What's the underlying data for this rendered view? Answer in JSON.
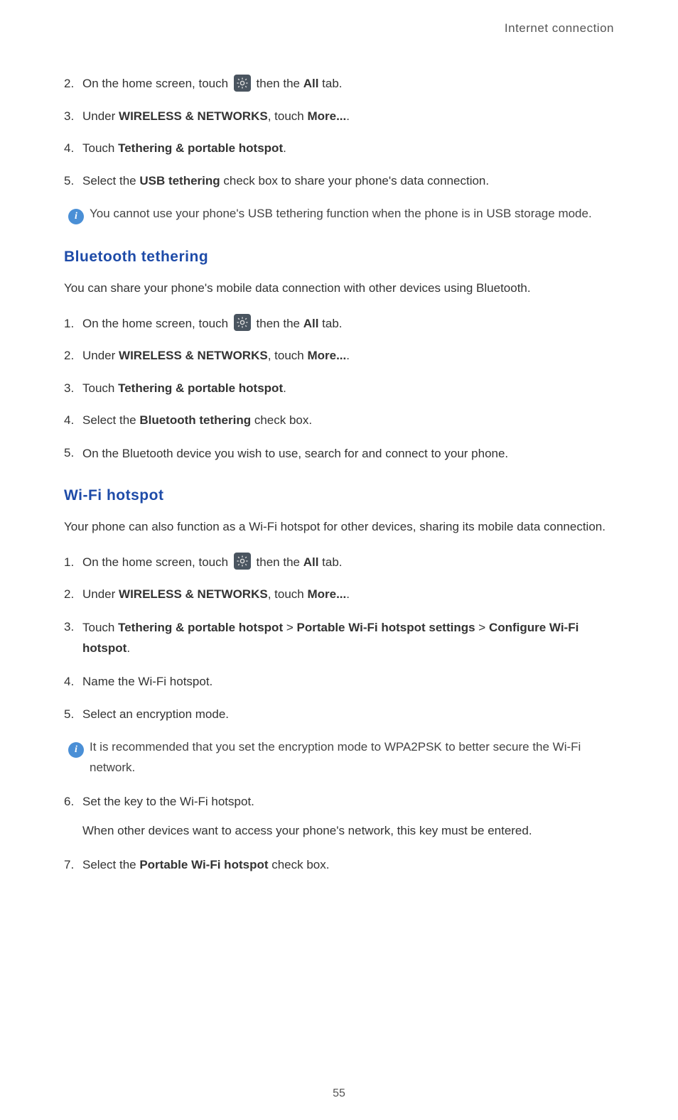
{
  "header": "Internet connection",
  "usb": {
    "step2": {
      "num": "2.",
      "pre": "On the home screen, touch ",
      "post": " then the ",
      "bold": "All",
      "end": " tab."
    },
    "step3": {
      "num": "3.",
      "pre": "Under ",
      "b1": "WIRELESS & NETWORKS",
      "mid": ", touch ",
      "b2": "More...",
      "end": "."
    },
    "step4": {
      "num": "4.",
      "pre": "Touch ",
      "b1": "Tethering & portable hotspot",
      "end": "."
    },
    "step5": {
      "num": "5.",
      "pre": "Select the ",
      "b1": "USB tethering",
      "end": " check box to share your phone's data connection."
    },
    "note": "You cannot use your phone's USB tethering function when the phone is in USB storage mode."
  },
  "bt": {
    "heading": "Bluetooth tethering",
    "desc": "You can share your phone's mobile data connection with other devices using Bluetooth.",
    "step1": {
      "num": "1.",
      "pre": "On the home screen, touch ",
      "post": " then the ",
      "bold": "All",
      "end": " tab."
    },
    "step2": {
      "num": "2.",
      "pre": "Under ",
      "b1": "WIRELESS & NETWORKS",
      "mid": ", touch ",
      "b2": "More...",
      "end": "."
    },
    "step3": {
      "num": "3.",
      "pre": "Touch ",
      "b1": "Tethering & portable hotspot",
      "end": "."
    },
    "step4": {
      "num": "4.",
      "pre": "Select the ",
      "b1": "Bluetooth tethering",
      "end": " check box."
    },
    "step5": {
      "num": "5.",
      "text": "On the Bluetooth device you wish to use, search for and connect to your phone."
    }
  },
  "wifi": {
    "heading": "Wi-Fi hotspot",
    "desc": "Your phone can also function as a Wi-Fi hotspot for other devices, sharing its mobile data connection.",
    "step1": {
      "num": "1.",
      "pre": "On the home screen, touch ",
      "post": " then the ",
      "bold": "All",
      "end": " tab."
    },
    "step2": {
      "num": "2.",
      "pre": "Under ",
      "b1": "WIRELESS & NETWORKS",
      "mid": ", touch ",
      "b2": "More...",
      "end": "."
    },
    "step3": {
      "num": "3.",
      "pre": "Touch ",
      "b1": "Tethering & portable hotspot",
      "sep1": " > ",
      "b2": "Portable Wi-Fi hotspot settings",
      "sep2": " > ",
      "b3": "Configure Wi-Fi hotspot",
      "end": "."
    },
    "step4": {
      "num": "4.",
      "text": "Name the Wi-Fi hotspot."
    },
    "step5": {
      "num": "5.",
      "text": "Select an encryption mode."
    },
    "note": "It is recommended that you set the encryption mode to WPA2PSK to better secure the Wi-Fi network.",
    "step6": {
      "num": "6.",
      "text": "Set the key to the Wi-Fi hotspot.",
      "sub": "When other devices want to access your phone's network, this key must be entered."
    },
    "step7": {
      "num": "7.",
      "pre": "Select the ",
      "b1": "Portable Wi-Fi hotspot",
      "end": " check box."
    }
  },
  "pageNumber": "55",
  "infoGlyph": "i"
}
